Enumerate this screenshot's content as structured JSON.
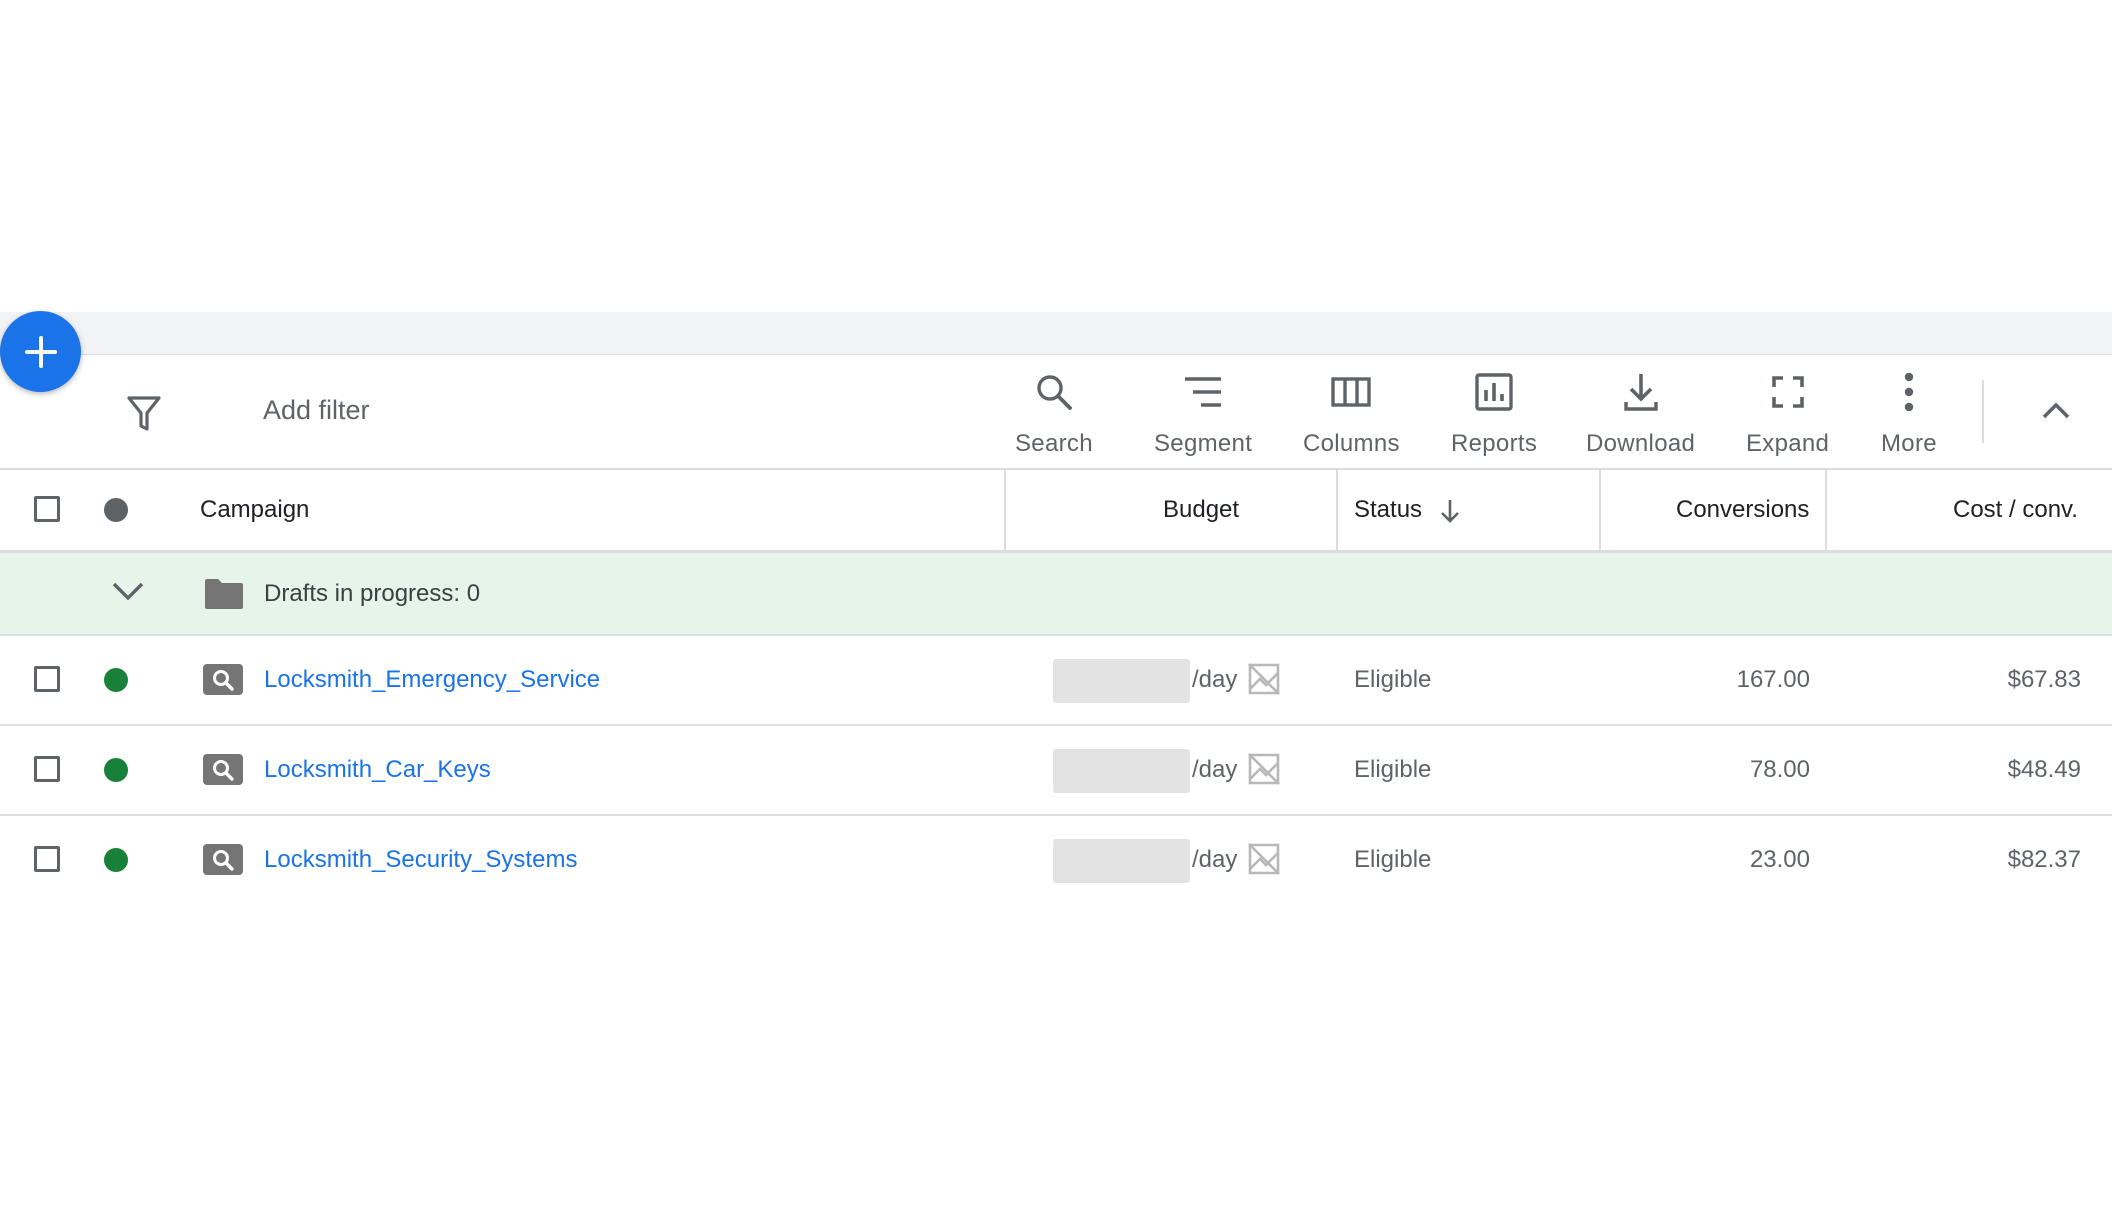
{
  "fab": {
    "icon": "plus-icon"
  },
  "toolbar": {
    "add_filter": "Add filter",
    "tools": [
      {
        "label": "Search",
        "icon": "search-icon"
      },
      {
        "label": "Segment",
        "icon": "segment-icon"
      },
      {
        "label": "Columns",
        "icon": "columns-icon"
      },
      {
        "label": "Reports",
        "icon": "reports-icon"
      },
      {
        "label": "Download",
        "icon": "download-icon"
      },
      {
        "label": "Expand",
        "icon": "expand-icon"
      },
      {
        "label": "More",
        "icon": "more-vert-icon"
      }
    ]
  },
  "table": {
    "headers": {
      "campaign": "Campaign",
      "budget": "Budget",
      "status": "Status",
      "conversions": "Conversions",
      "cost_conv": "Cost / conv."
    },
    "drafts_label": "Drafts in progress: 0",
    "rows": [
      {
        "campaign": "Locksmith_Emergency_Service",
        "budget_suffix": "/day",
        "status": "Eligible",
        "conversions": "167.00",
        "cost_conv": "$67.83"
      },
      {
        "campaign": "Locksmith_Car_Keys",
        "budget_suffix": "/day",
        "status": "Eligible",
        "conversions": "78.00",
        "cost_conv": "$48.49"
      },
      {
        "campaign": "Locksmith_Security_Systems",
        "budget_suffix": "/day",
        "status": "Eligible",
        "conversions": "23.00",
        "cost_conv": "$82.37"
      }
    ]
  },
  "colors": {
    "accent": "#1a73e8",
    "status_enabled": "#188038",
    "drafts_bg": "#e6f4ea",
    "header_dot": "#5f6368"
  }
}
